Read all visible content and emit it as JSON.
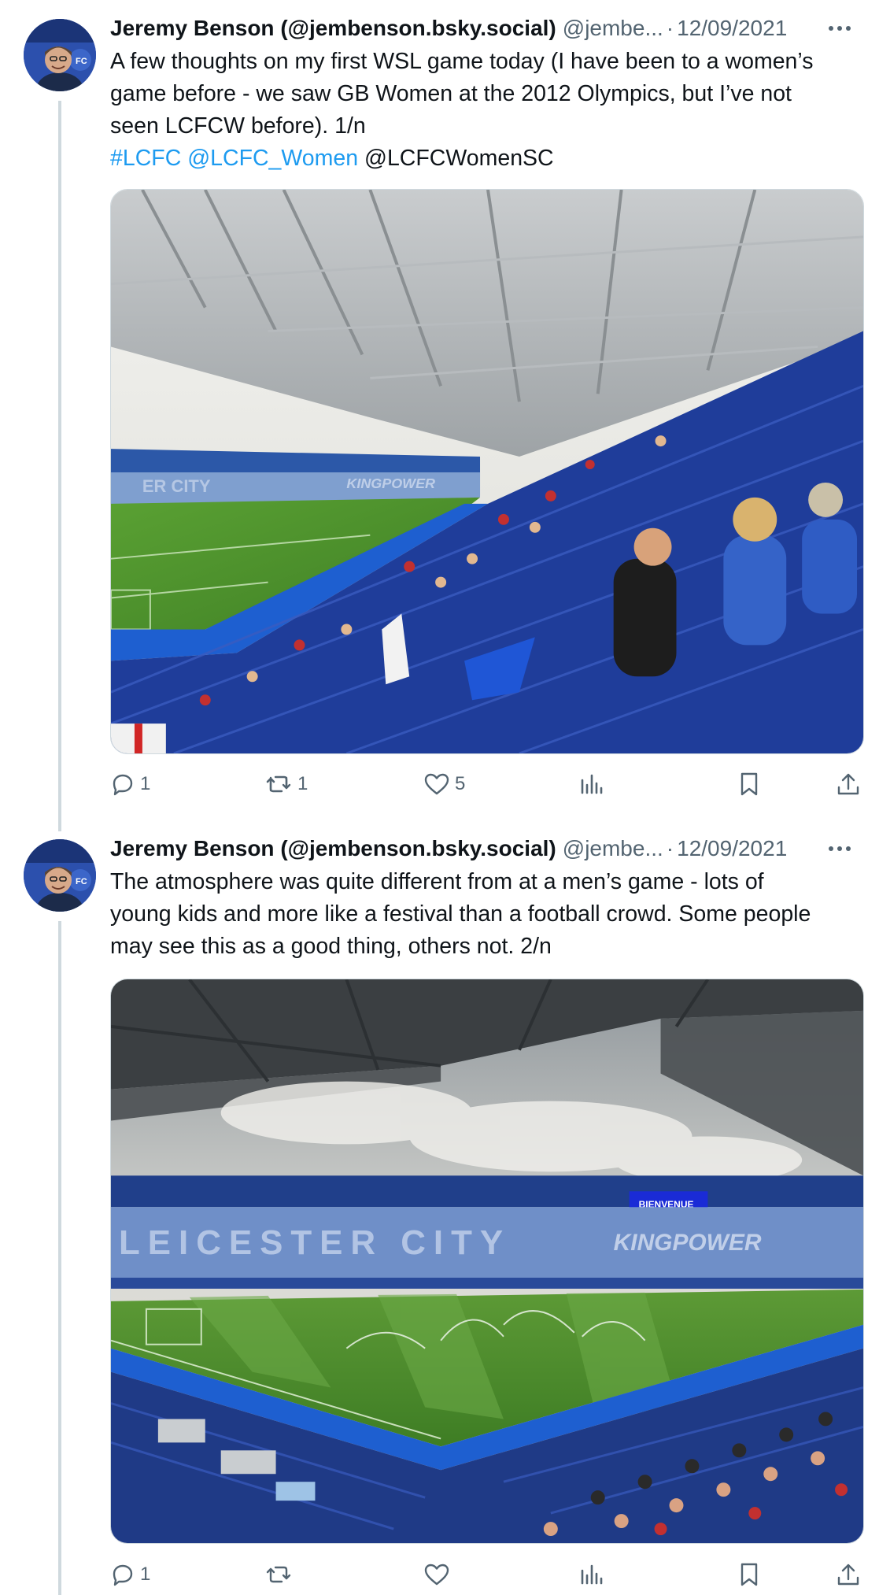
{
  "tweets": [
    {
      "author_name": "Jeremy Benson (@jembenson.bsky.social)",
      "handle": "@jembe...",
      "separator": "·",
      "date": "12/09/2021",
      "more_icon": "more-horizontal-icon",
      "text_lines": [
        "A few thoughts on my first WSL game today (I have been to a women’s",
        "game before - we saw GB Women at the 2012 Olympics, but I’ve not",
        "seen LCFCW before). 1/n"
      ],
      "tags": {
        "hashtag": "#LCFC",
        "mention_link": "@LCFC_Women",
        "mention_plain": "@LCFCWomenSC"
      },
      "image": "stadium-stand-photo",
      "actions": {
        "replies": "1",
        "reposts": "1",
        "likes": "5",
        "views": "",
        "bookmark": "",
        "share": ""
      }
    },
    {
      "author_name": "Jeremy Benson (@jembenson.bsky.social)",
      "handle": "@jembe...",
      "separator": "·",
      "date": "12/09/2021",
      "more_icon": "more-horizontal-icon",
      "text_lines": [
        "The atmosphere was quite different from at a men’s game - lots of",
        "young kids and more like a festival than a football crowd. Some people",
        "may see this as a good thing, others not. 2/n"
      ],
      "image": "stadium-pitch-photo",
      "image_texts": {
        "stand_lettering": "LEICESTER CITY",
        "sponsor_lettering": "KINGPOWER",
        "screen_text": "BIENVENUE"
      },
      "actions": {
        "replies": "1",
        "reposts": "",
        "likes": "",
        "views": "",
        "bookmark": "",
        "share": ""
      }
    }
  ],
  "colors": {
    "text": "#0f1419",
    "secondary": "#536471",
    "link": "#1d9bf0",
    "thread_line": "#cfd9de",
    "seat_blue": "#1f3d9a",
    "pitch_green": "#4f8f2e",
    "track_blue": "#1e5fd0"
  }
}
